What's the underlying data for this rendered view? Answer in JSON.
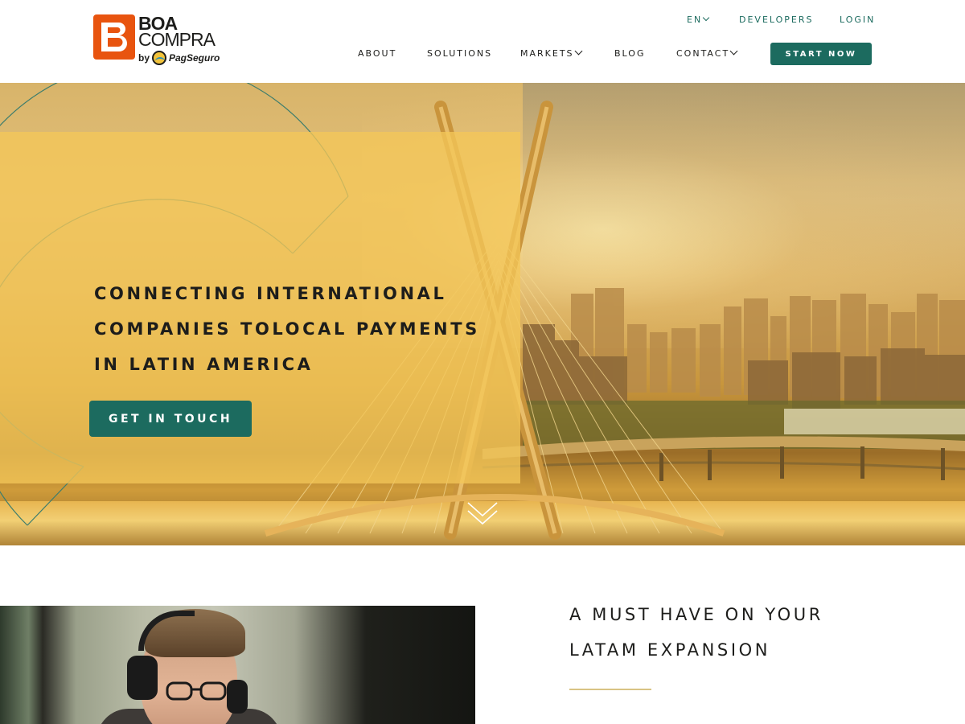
{
  "header": {
    "logo": {
      "word1": "BOA",
      "word2": "COMPRA",
      "by": "by",
      "partner": "PagSeguro"
    },
    "utility_nav": {
      "language": "EN",
      "developers": "DEVELOPERS",
      "login": "LOGIN"
    },
    "main_nav": {
      "about": "ABOUT",
      "solutions": "SOLUTIONS",
      "markets": "MARKETS",
      "blog": "BLOG",
      "contact": "CONTACT"
    },
    "cta_label": "START NOW"
  },
  "hero": {
    "title_lines": [
      "CONNECTING INTERNATIONAL",
      "COMPANIES TOLOCAL PAYMENTS",
      "IN LATIN AMERICA"
    ],
    "cta_label": "GET IN TOUCH"
  },
  "section": {
    "title_lines": [
      "A MUST HAVE ON YOUR",
      "LATAM EXPANSION"
    ]
  },
  "colors": {
    "brand_orange": "#e8540f",
    "brand_green": "#1c6b5f",
    "panel_yellow": "#f3c758",
    "accent_rule": "#d9c384"
  },
  "icons": {
    "language_dropdown": "chevron-down-icon",
    "markets_dropdown": "chevron-down-icon",
    "contact_dropdown": "chevron-down-icon",
    "scroll_down": "double-chevron-down-icon",
    "logo_mark": "boacompra-b-icon",
    "partner_mark": "pagseguro-icon"
  }
}
